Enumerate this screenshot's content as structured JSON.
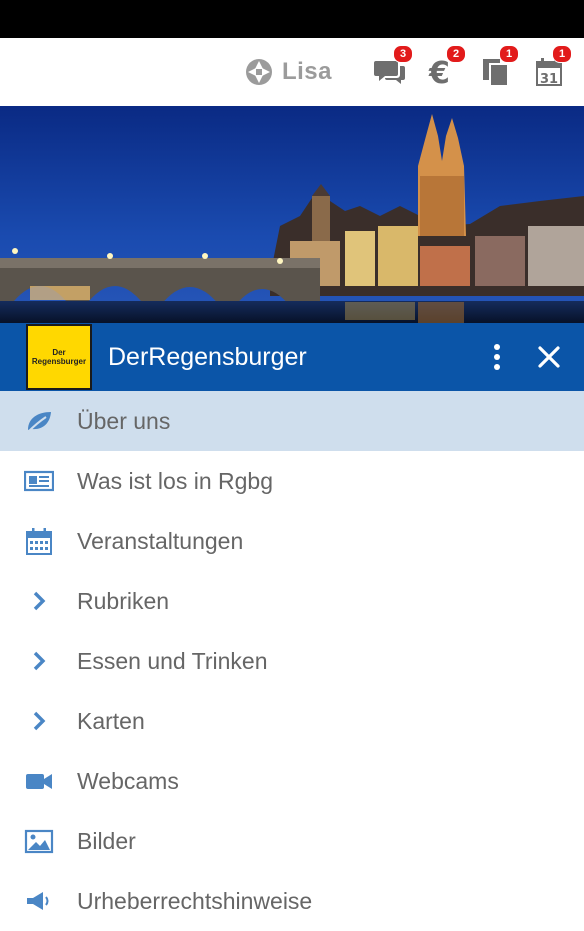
{
  "topbar": {
    "user_name": "Lisa",
    "badges": {
      "messages": "3",
      "payments": "2",
      "documents": "1",
      "calendar": "1"
    }
  },
  "brand": {
    "logo_line1": "Der",
    "logo_line2": "Regensburger",
    "name": "DerRegensburger"
  },
  "menu": {
    "items": [
      {
        "label": "Über uns",
        "icon": "leaf-icon",
        "active": true
      },
      {
        "label": "Was ist los in Rgbg",
        "icon": "newspaper-icon"
      },
      {
        "label": "Veranstaltungen",
        "icon": "calendar-icon"
      },
      {
        "label": "Rubriken",
        "icon": "chevron-right-icon"
      },
      {
        "label": "Essen und Trinken",
        "icon": "chevron-right-icon"
      },
      {
        "label": "Karten",
        "icon": "chevron-right-icon"
      },
      {
        "label": "Webcams",
        "icon": "video-camera-icon"
      },
      {
        "label": "Bilder",
        "icon": "image-icon"
      },
      {
        "label": "Urheberrechtshinweise",
        "icon": "megaphone-icon"
      }
    ]
  },
  "colors": {
    "brand_blue": "#0b55a8",
    "active_row": "#cfdeed",
    "icon_blue": "#4a86c5",
    "badge_red": "#e21b1b",
    "logo_yellow": "#ffd800"
  }
}
